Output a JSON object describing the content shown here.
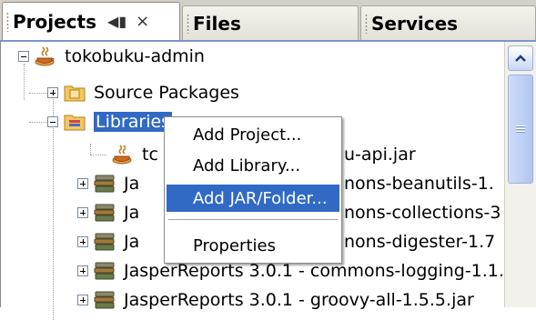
{
  "tabs": [
    {
      "label": "Projects",
      "active": true
    },
    {
      "label": "Files",
      "active": false
    },
    {
      "label": "Services",
      "active": false
    }
  ],
  "tab_controls": {
    "minimize": "◀▮",
    "close": "×"
  },
  "tree": {
    "root": {
      "label": "tokobuku-admin",
      "icon": "coffee-cup-icon"
    },
    "source_packages": {
      "label": "Source Packages",
      "icon": "package-folder-icon"
    },
    "libraries": {
      "label": "Libraries",
      "icon": "library-folder-icon",
      "selected": true
    },
    "jars": [
      {
        "left": "tc",
        "right": "u-api.jar",
        "icon": "coffee-cup-icon"
      },
      {
        "left": "Ja",
        "right": "nons-beanutils-1.",
        "icon": "books-icon"
      },
      {
        "left": "Ja",
        "right": "nons-collections-3",
        "icon": "books-icon"
      },
      {
        "left": "Ja",
        "right": "nons-digester-1.7",
        "icon": "books-icon"
      },
      {
        "label": "JasperReports 3.0.1 - commons-logging-1.1.",
        "icon": "books-icon"
      },
      {
        "label": "JasperReports 3.0.1 - groovy-all-1.5.5.jar",
        "icon": "books-icon"
      }
    ]
  },
  "context_menu": {
    "items": [
      {
        "label": "Add Project...",
        "highlighted": false
      },
      {
        "label": "Add Library...",
        "highlighted": false
      },
      {
        "label": "Add JAR/Folder...",
        "highlighted": true
      },
      {
        "label": "Properties",
        "highlighted": false
      }
    ]
  },
  "colors": {
    "selection": "#316ac5",
    "tab_strip": "#d4d0c8",
    "scroll_accent": "#9ab2dc"
  }
}
